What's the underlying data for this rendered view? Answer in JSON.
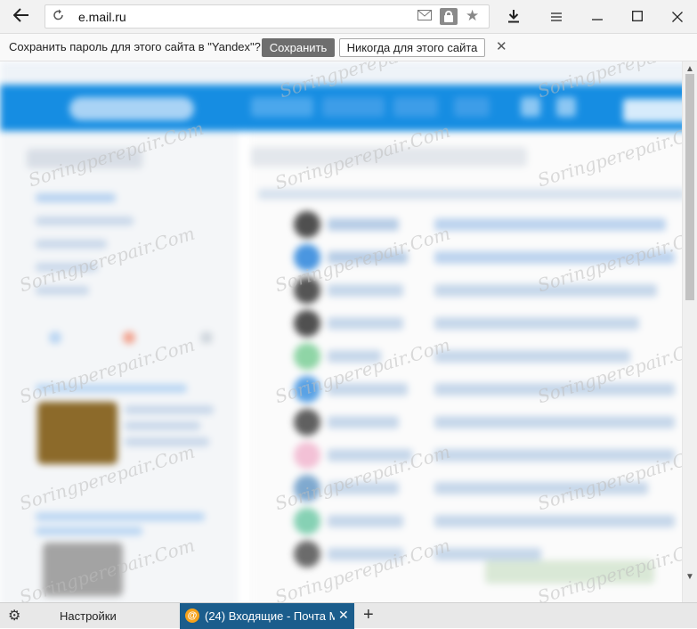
{
  "browser": {
    "url": "e.mail.ru",
    "icons": {
      "back": "arrow-left-icon",
      "reload": "reload-icon",
      "mail": "envelope-icon",
      "lock": "lock-icon",
      "bookmark": "star-icon",
      "download": "download-icon",
      "menu": "hamburger-icon",
      "minimize": "minimize-icon",
      "maximize": "maximize-icon",
      "close": "close-icon"
    }
  },
  "password_bar": {
    "message": "Сохранить пароль для этого сайта в \"Yandex\"?",
    "save_label": "Сохранить",
    "never_label": "Никогда для этого сайта",
    "close_symbol": "✕"
  },
  "watermark": {
    "text": "Soringperepair.Com"
  },
  "tabs": {
    "settings_label": "Настройки",
    "active_tab_title": "(24) Входящие - Почта М",
    "active_tab_close": "✕",
    "new_tab": "+"
  },
  "colors": {
    "header_blue": "#168de2",
    "active_tab": "#1b5d8c",
    "save_button": "#6e6e6e"
  }
}
